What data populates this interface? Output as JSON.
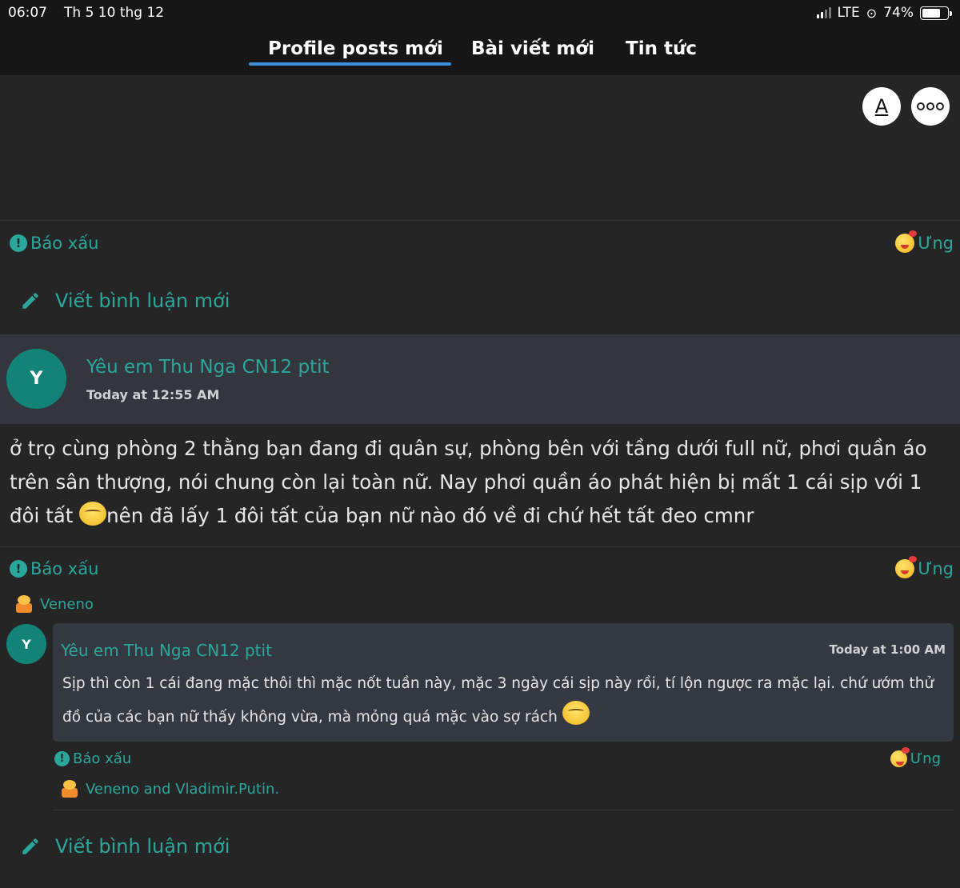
{
  "status_bar": {
    "time": "06:07",
    "date": "Th 5 10 thg 12",
    "network": "LTE",
    "battery": "74%",
    "battery_level": 0.74
  },
  "tabs": [
    {
      "label": "Profile posts mới",
      "active": true
    },
    {
      "label": "Bài viết mới",
      "active": false
    },
    {
      "label": "Tin tức",
      "active": false
    }
  ],
  "top_buttons": {
    "font_icon_letter": "A",
    "more_icon": "more-icon"
  },
  "first_post": {
    "report_label": "Báo xấu",
    "like_label": "Ưng",
    "compose_label": "Viết bình luận mới"
  },
  "post": {
    "avatar_letter": "Y",
    "author": "Yêu em Thu Nga CN12 ptit",
    "time": "Today at 12:55 AM",
    "body_part1": "ở trọ cùng phòng 2 thằng bạn đang đi quân sự, phòng bên với tầng dưới full nữ, phơi quần áo trên sân thượng, nói chung còn lại toàn nữ. Nay phơi quần áo phát hiện bị mất 1 cái sịp với 1 đôi tất ",
    "body_part2": "nên đã lấy 1 đôi tất của bạn nữ nào đó về đi chứ hết tất đeo cmnr",
    "report_label": "Báo xấu",
    "like_label": "Ưng",
    "liked_by": "Veneno"
  },
  "comment": {
    "avatar_letter": "Y",
    "author": "Yêu em Thu Nga CN12 ptit",
    "time": "Today at 1:00 AM",
    "body": "Sịp thì còn 1 cái đang mặc thôi thì mặc nốt tuần này, mặc 3 ngày cái sịp này rồi, tí lộn ngược ra mặc lại. chứ ướm thử đồ của các bạn nữ thấy không vừa, mà mỏng quá mặc vào sợ rách ",
    "report_label": "Báo xấu",
    "like_label": "Ưng",
    "liked_by": "Veneno and Vladimir.Putin."
  },
  "compose_bottom": {
    "label": "Viết bình luận mới"
  },
  "colors": {
    "accent_teal": "#2aa79a",
    "tab_underline": "#3c8fd9",
    "avatar_bg": "#138377",
    "background": "#252526"
  }
}
